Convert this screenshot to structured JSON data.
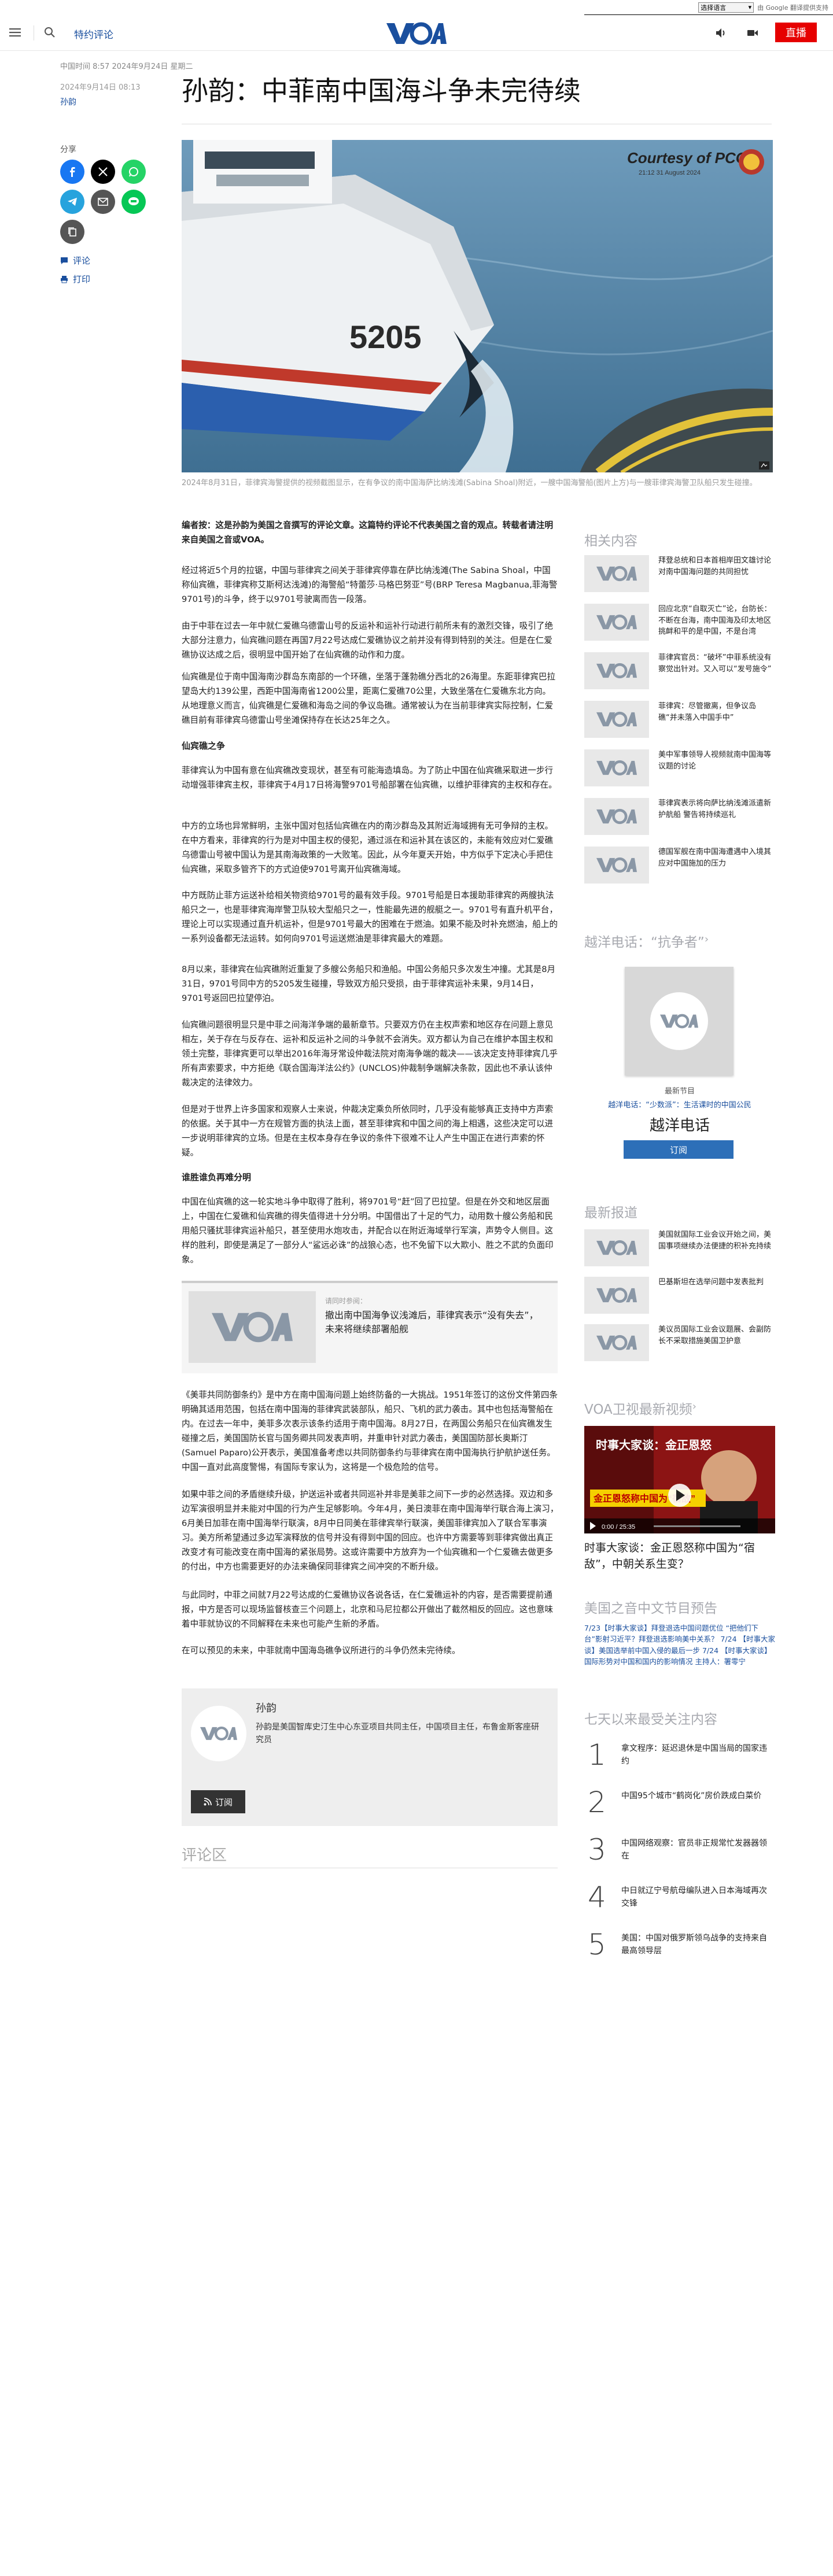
{
  "translate_bar": {
    "select_label": "选择语言",
    "powered_by": "由 Google 翻译提供支持",
    "google": "Google",
    "brand": "翻译"
  },
  "header": {
    "topic": "特约评论",
    "live_label": "直播"
  },
  "article": {
    "breadcrumb": "中国时间 8:57 2024年9月24日 星期二",
    "date": "2024年9月14日 08:13",
    "author": "孙韵",
    "title": "孙韵：中菲南中国海斗争未完待续",
    "share_label": "分享",
    "comment_label": "评论",
    "print_label": "打印",
    "image_badge": "Courtesy of PCG",
    "image_badge_time": "21:12 31 August 2024",
    "ship_number": "5205",
    "caption": "2024年8月31日，菲律宾海警提供的视频截图显示，在有争议的南中国海萨比纳浅滩(Sabina Shoal)附近，一艘中国海警船(图片上方)与一艘菲律宾海警卫队船只发生碰撞。",
    "paragraphs": [
      "编者按：这是孙韵为美国之音撰写的评论文章。这篇特约评论不代表美国之音的观点。转载者请注明来自美国之音或VOA。",
      "经过将近5个月的拉锯，中国与菲律宾之间关于菲律宾停靠在萨比纳浅滩(The Sabina Shoal，中国称仙宾礁，菲律宾称艾斯柯达浅滩)的海警船“特蕾莎·马格巴努亚”号(BRP Teresa Magbanua,菲海警9701号)的斗争，终于以9701号驶离而告一段落。",
      "由于中菲在过去一年中就仁爱礁乌德雷山号的反运补和运补行动进行前所未有的激烈交锋，吸引了绝大部分注意力，仙宾礁问题在再国7月22号达成仁爱礁协议之前并没有得到特别的关注。但是在仁爱礁协议达成之后，很明显中国开始了在仙宾礁的动作和力度。",
      "仙宾礁是位于南中国海南沙群岛东南部的一个环礁，坐落于蓬勃礁分西北的26海里。东距菲律宾巴拉望岛大约139公里，西距中国海南省1200公里，距离仁爱礁70公里，大致坐落在仁爱礁东北方向。从地理意义而言，仙宾礁是仁爱礁和海岛之间的争议岛礁。通常被认为在当前菲律宾实际控制，仁爱礁目前有菲律宾乌德雷山号坐滩保持存在长达25年之久。",
      "菲律宾认为中国有意在仙宾礁改变现状，甚至有可能海造填岛。为了防止中国在仙宾礁采取进一步行动增强菲律宾主权，菲律宾于4月17日将海警9701号船部署在仙宾礁，以维护菲律宾的主权和存在。",
      "中方的立场也异常鲜明，主张中国对包括仙宾礁在内的南沙群岛及其附近海域拥有无可争辩的主权。在中方看来，菲律宾的行为是对中国主权的侵犯，通过派在和运补其在该区的，未能有效应对仁爱礁乌德雷山号被中国认为是其南海政策的一大败笔。因此，从今年夏天开始，中方似乎下定决心手把住仙宾礁，采取多管齐下的方式迫使9701号离开仙宾礁海域。",
      "中方既防止菲方运送补给相关物资给9701号的最有效手段。9701号船是日本援助菲律宾的两艘执法船只之一，也是菲律宾海岸警卫队较大型船只之一，性能最先进的舰艇之一。9701号有直升机平台，理论上可以实现通过直升机运补，但是9701号最大的困难在于燃油。如果不能及时补充燃油，船上的一系列设备都无法运转。如何向9701号运送燃油是菲律宾最大的难题。",
      "8月以来，菲律宾在仙宾礁附近重复了多艘公务船只和渔船。中国公务船只多次发生冲撞。尤其是8月31日，9701号同中方的5205发生碰撞，导致双方船只受损，由于菲律宾运补未果，9月14日，9701号返回巴拉望停泊。",
      "仙宾礁问题很明显只是中菲之间海洋争端的最新章节。只要双方仍在主权声索和地区存在问题上意见相左，关于存在与反存在、运补和反运补之间的斗争就不会消失。双方都认为自己在维护本国主权和领土完整，菲律宾更可以举出2016年海牙常设仲裁法院对南海争端的裁决——该决定支持菲律宾几乎所有声索要求，中方拒绝《联合国海洋法公约》(UNCLOS)仲裁制争端解决条款，因此也不承认该仲裁决定的法律效力。",
      "但是对于世界上许多国家和观察人士来说，仲裁决定乘负所依同时，几乎没有能够真正支持中方声索的依据。关于其中一方在规管方面的执法上面，甚至菲律宾和中国之间的海上相遇，这些决定可以进一步说明菲律宾的立场。但是在主权本身存在争议的条件下很难不让人产生中国正在进行声索的怀疑。",
      "中国在仙宾礁的这一轮实地斗争中取得了胜利，将9701号“赶”回了巴拉望。但是在外交和地区层面上，中国在仁爱礁和仙宾礁的得失值得进十分分明。中国借出了十足的气力，动用数十艘公务船和民用船只骚扰菲律宾运补船只，甚至使用水炮攻击，并配合以在附近海域举行军演，声势令人侧目。这样的胜利，即使是满足了一部分人“鲨远必诛”的战狼心态，也不免留下以大欺小、胜之不武的负面印象。",
      "《美菲共同防御条约》是中方在南中国海问题上始终防备的一大挑战。1951年签订的这份文件第四条明确其适用范围，包括在南中国海的菲律宾武装部队，船只、飞机的武力袭击。其中也包括海警船在内。在过去一年中，美菲多次表示该条约适用于南中国海。8月27日，在两国公务船只在仙宾礁发生碰撞之后，美国国防长官与国务卿共同发表声明，并重申针对武力袭击，美国国防部长奥斯汀(Samuel Paparo)公开表示，美国准备考虑以共同防御条约与菲律宾在南中国海执行护航护送任务。中国一直对此高度警惕，有国际专家认为，这将是一个极危险的信号。",
      "如果中菲之间的矛盾继续升级，护送运补或者共同巡补并非是美菲之间下一步的必然选择。双边和多边军演很明显并未能对中国的行为产生足够影响。今年4月，美日澳菲在南中国海举行联合海上演习，6月美日加菲在南中国海举行联演，8月中日同美在菲律宾举行联演，美国菲律宾加入了联合军事演习。美方所希望通过多边军演释放的信号并没有得到中国的回应。也许中方需要等到菲律宾做出真正改变才有可能改变在南中国海的紧张局势。这或许需要中方放弃为一个仙宾礁和一个仁爱礁去做更多的付出，中方也需要更好的办法来确保同菲律宾之间冲突的不断升级。",
      "与此同时，中菲之间就7月22号达成的仁爱礁协议各说各话，在仁爱礁运补的内容，是否需要提前通报，中方是否可以现场监督核查三个问题上，北京和马尼拉都公开做出了截然相反的回应。这也意味着中菲就协议的不同解释在未来也可能产生新的矛盾。",
      "在可以预见的未来，中菲就南中国海岛礁争议所进行的斗争仍然未完待续。"
    ],
    "subheads": [
      "仙宾礁之争",
      "谁胜谁负再难分明"
    ],
    "related_card": {
      "kicker": "请同时参阅：",
      "title": "撤出南中国海争议浅滩后，菲律宾表示“没有失去”，未来将继续部署船舰"
    },
    "author_box": {
      "name": "孙韵",
      "bio": "孙韵是美国智库史汀生中心东亚项目共同主任，中国项目主任，布鲁金斯客座研究员",
      "subscribe": "订阅"
    },
    "comments_title": "评论区"
  },
  "sidebar": {
    "related_title": "相关内容",
    "related": [
      "拜登总统和日本首相岸田文雄讨论对南中国海问题的共同担忧",
      "回应北京“自取灭亡”论，台防长：不断在台海，南中国海及印太地区挑衅和平的是中国，不是台湾",
      "菲律宾官员：“破坏”中菲系统没有察觉出针对。又入可以“发号施令”",
      "菲律宾：尽管撤离，但争议岛礁“并未落入中国手中”",
      "美中军事领导人视频就南中国海等议题的讨论",
      "菲律宾表示将向萨比纳浅滩派遣新护航船 警告将持续巡礼",
      "德国军舰在南中国海遭遇中入境其应对中国施加的压力"
    ],
    "radio_title": "越洋电话：“抗争者”",
    "radio_card": {
      "cover_label": "越洋电话",
      "sub": "最新节目",
      "link": "越洋电话：“少数派”：生活课时的中国公民",
      "name": "越洋电话",
      "subscribe": "订阅"
    },
    "latest_title": "最新报道",
    "latest": [
      "美国就国际工业会议开始之间，美国事项继续办法便捷的积补充持续",
      "巴基斯坦在选举问题中发表批判",
      "美议员国际工业会议题展、会副防长不采取措施美国卫护意"
    ],
    "video_title": "VOA卫视最新视频",
    "video": {
      "thumb_title": "时事大家谈：金正恩怒",
      "thumb_sub": "金正恩怒称中国为“宿敌”",
      "time": "0:00 / 25:35",
      "caption": "时事大家谈：金正恩怒称中国为“宿敌”，中朝关系生变？"
    },
    "preview_title": "美国之音中文节目预告",
    "preview_text": "7/23【时事大家谈】拜登退选中国问题优位 “把他们下台”影射习近平？拜登退选影响美中关系？ 7/24 【时事大家谈】美国选举前中国入侵的最后一步 7/24 【时事大家谈】国际形势对中国和国内的影响情况 主持人：署零宁",
    "popular_title": "七天以来最受关注内容",
    "popular": [
      "拿文程序：延迟退休是中国当局的国家违约",
      "中国95个城市“鹤岗化”房价跌成白菜价",
      "中国网络观察：官员非正规常忙发器器领在",
      "中日就辽宁号航母编队进入日本海域再次交锋",
      "美国：中国对俄罗斯领乌战争的支持来自最高领导层"
    ]
  },
  "colors": {
    "brand_blue": "#1a4f9e",
    "live_red": "#e60000",
    "subscribe_blue": "#2d6fb8"
  }
}
